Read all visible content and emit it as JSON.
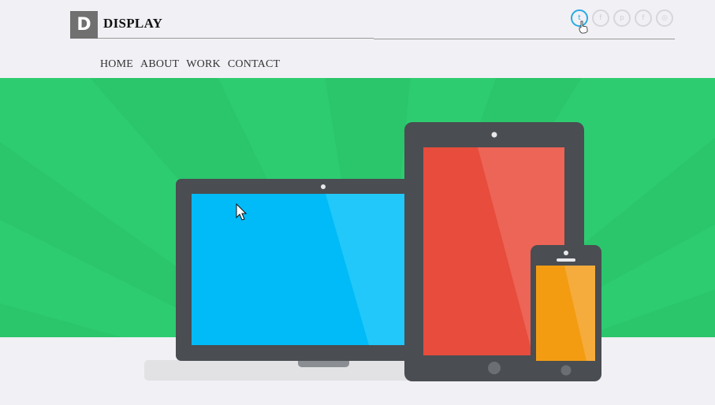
{
  "brand": {
    "initial": "D",
    "name": "DISPLAY"
  },
  "social": [
    {
      "name": "twitter",
      "glyph": "t",
      "active": true
    },
    {
      "name": "facebook",
      "glyph": "f",
      "active": false
    },
    {
      "name": "pinterest",
      "glyph": "p",
      "active": false
    },
    {
      "name": "facebook-alt",
      "glyph": "f",
      "active": false
    },
    {
      "name": "dribbble",
      "glyph": "◎",
      "active": false
    }
  ],
  "nav": {
    "home": "HOME",
    "about": "ABOUT",
    "work": "WORK",
    "contact": "CONTACT"
  },
  "colors": {
    "hero_green": "#2ecc71",
    "laptop_screen": "#00bbf7",
    "tablet_screen": "#e74c3c",
    "phone_screen": "#f39c12",
    "device_frame": "#4a4d52",
    "social_active": "#29abe2"
  }
}
